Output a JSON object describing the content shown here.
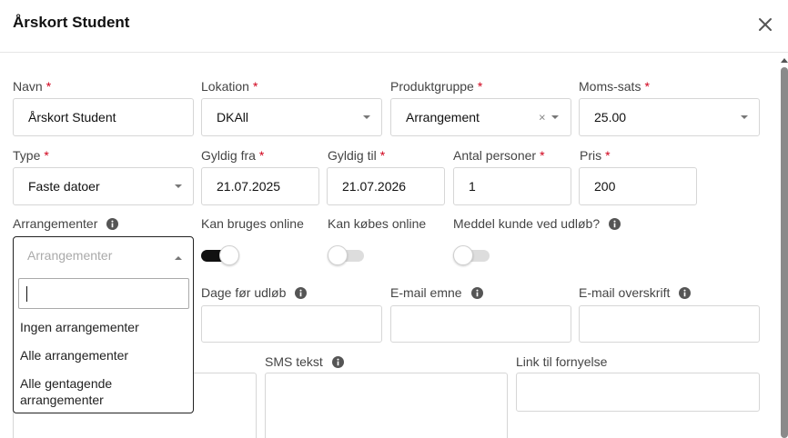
{
  "modal": {
    "title": "Årskort Student",
    "close_icon": "close-icon"
  },
  "form": {
    "required_mark": "*",
    "navn": {
      "label": "Navn",
      "value": "Årskort Student"
    },
    "lokation": {
      "label": "Lokation",
      "value": "DKAll"
    },
    "produktgruppe": {
      "label": "Produktgruppe",
      "value": "Arrangement",
      "clear": "×"
    },
    "moms_sats": {
      "label": "Moms-sats",
      "value": "25.00"
    },
    "type": {
      "label": "Type",
      "value": "Faste datoer"
    },
    "gyldig_fra": {
      "label": "Gyldig fra",
      "value": "21.07.2025"
    },
    "gyldig_til": {
      "label": "Gyldig til",
      "value": "21.07.2026"
    },
    "antal_personer": {
      "label": "Antal personer",
      "value": "1"
    },
    "pris": {
      "label": "Pris",
      "value": "200"
    },
    "arrangementer": {
      "label": "Arrangementer",
      "placeholder": "Arrangementer",
      "search_value": "",
      "options": [
        "Ingen arrangementer",
        "Alle arrangementer",
        "Alle gentagende arrangementer"
      ]
    },
    "kan_bruges_online": {
      "label": "Kan bruges online",
      "on": true
    },
    "kan_koebes_online": {
      "label": "Kan købes online",
      "on": false
    },
    "meddel_kunde": {
      "label": "Meddel kunde ved udløb?",
      "on": false
    },
    "dage_foer_udloeb": {
      "label": "Dage før udløb",
      "value": ""
    },
    "email_emne": {
      "label": "E-mail emne",
      "value": ""
    },
    "email_overskrift": {
      "label": "E-mail overskrift",
      "value": ""
    },
    "sms_tekst": {
      "label": "SMS tekst",
      "value": ""
    },
    "link_til_fornyelse": {
      "label": "Link til fornyelse",
      "value": ""
    }
  },
  "colors": {
    "required": "#d0021b",
    "toggle_on": "#111111",
    "toggle_off": "#dddddd"
  }
}
